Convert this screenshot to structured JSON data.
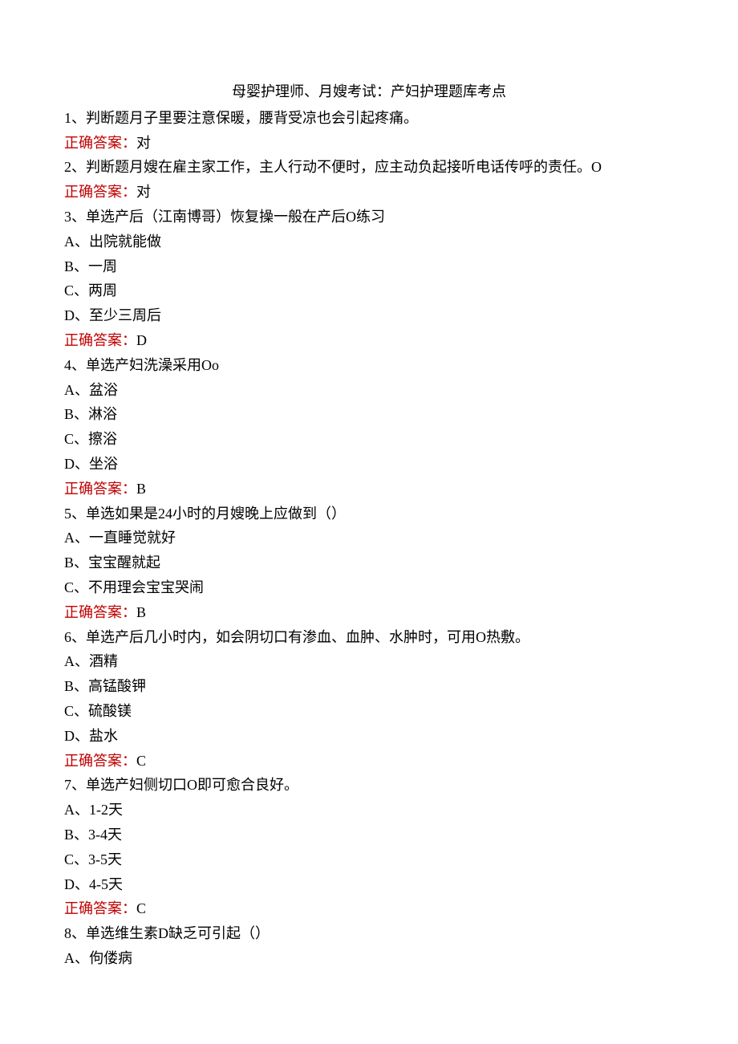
{
  "title": "母婴护理师、月嫂考试：产妇护理题库考点",
  "answer_label": "正确答案：",
  "questions": [
    {
      "num": "1",
      "type": "判断题",
      "text": "月子里要注意保暖，腰背受凉也会引起疼痛。",
      "options": [],
      "answer": "对"
    },
    {
      "num": "2",
      "type": "判断题",
      "text": "月嫂在雇主家工作，主人行动不便时，应主动负起接听电话传呼的责任。O",
      "options": [],
      "answer": "对"
    },
    {
      "num": "3",
      "type": "单选",
      "text": "产后（江南博哥）恢复操一般在产后O练习",
      "options": [
        "A、出院就能做",
        "B、一周",
        "C、两周",
        "D、至少三周后"
      ],
      "answer": "D"
    },
    {
      "num": "4",
      "type": "单选",
      "text": "产妇洗澡采用Oo",
      "options": [
        "A、盆浴",
        "B、淋浴",
        "C、擦浴",
        "D、坐浴"
      ],
      "answer": "B"
    },
    {
      "num": "5",
      "type": "单选",
      "text": "如果是24小时的月嫂晚上应做到（）",
      "options": [
        "A、一直睡觉就好",
        "B、宝宝醒就起",
        "C、不用理会宝宝哭闹"
      ],
      "answer": "B"
    },
    {
      "num": "6",
      "type": "单选",
      "text": "产后几小时内，如会阴切口有渗血、血肿、水肿时，可用O热敷。",
      "options": [
        "A、酒精",
        "B、高锰酸钾",
        "C、硫酸镁",
        "D、盐水"
      ],
      "answer": "C"
    },
    {
      "num": "7",
      "type": "单选",
      "text": "产妇侧切口O即可愈合良好。",
      "options": [
        "A、1-2天",
        "B、3-4天",
        "C、3-5天",
        "D、4-5天"
      ],
      "answer": "C"
    },
    {
      "num": "8",
      "type": "单选",
      "text": "维生素D缺乏可引起（）",
      "options": [
        "A、佝偻病"
      ],
      "answer": null
    }
  ]
}
